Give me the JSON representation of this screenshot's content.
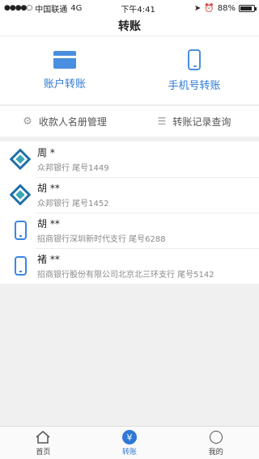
{
  "status_bar": {
    "carrier": "中国联通",
    "network": "4G",
    "time": "下午4:41",
    "battery": "88%",
    "battery_level": 0.88
  },
  "nav": {
    "title": "转账"
  },
  "actions": [
    {
      "label": "账户转账",
      "icon": "bank-card-icon"
    },
    {
      "label": "手机号转账",
      "icon": "mobile-phone-icon"
    }
  ],
  "subactions": [
    {
      "label": "收款人名册管理",
      "icon": "gear-icon"
    },
    {
      "label": "转账记录查询",
      "icon": "list-icon"
    }
  ],
  "payees": [
    {
      "name": "周 *",
      "detail": "众邦银行 尾号1449",
      "icon": "bank-logo-icon"
    },
    {
      "name": "胡 **",
      "detail": "众邦银行 尾号1452",
      "icon": "bank-logo-icon"
    },
    {
      "name": "胡 **",
      "detail": "招商银行深圳新时代支行 尾号6288",
      "icon": "mobile-phone-icon"
    },
    {
      "name": "褚 **",
      "detail": "招商银行股份有限公司北京北三环支行 尾号5142",
      "icon": "mobile-phone-icon"
    }
  ],
  "tabs": [
    {
      "label": "首页",
      "icon": "home-icon",
      "active": false
    },
    {
      "label": "转账",
      "icon": "yen-icon",
      "active": true
    },
    {
      "label": "我的",
      "icon": "profile-icon",
      "active": false
    }
  ],
  "colors": {
    "accent": "#2f79d4",
    "icon_blue": "#4a8ee0",
    "logo_blue": "#1f6fa8",
    "logo_teal": "#3aa6b6"
  }
}
